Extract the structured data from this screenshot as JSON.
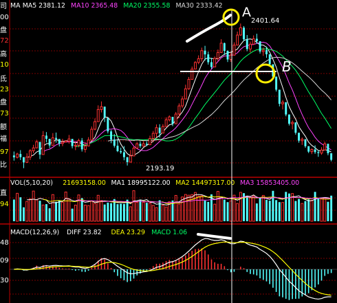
{
  "colors": {
    "background": "#000000",
    "grid": "#7a0000",
    "border": "#bb0000",
    "up": "#ff3232",
    "down": "#54ffff",
    "ma5": "#ffffff",
    "ma10": "#ff44ff",
    "ma20": "#00ff66",
    "ma30": "#d8d8d8",
    "macd_diff": "#ffffff",
    "macd_dea": "#ffff00",
    "annotation": "#ffffff",
    "circle": "#ffee00"
  },
  "price_panel": {
    "legend": [
      {
        "label": "MA",
        "color": "#ffffff"
      },
      {
        "label": "MA5 2381.12",
        "color": "#ffffff"
      },
      {
        "label": "MA10 2365.48",
        "color": "#ff44ff"
      },
      {
        "label": "MA20 2355.58",
        "color": "#00ff66"
      },
      {
        "label": "MA30 2333.42",
        "color": "#d8d8d8"
      }
    ],
    "side_labels": [
      {
        "text": "司",
        "color": "#ffffff"
      },
      {
        "text": "00",
        "color": "#ffffff"
      },
      {
        "text": "盘",
        "color": "#ffffff"
      },
      {
        "text": "72",
        "color": "#ff3232"
      },
      {
        "text": "高",
        "color": "#ffffff"
      },
      {
        "text": "10",
        "color": "#ffff00"
      },
      {
        "text": "氐",
        "color": "#ffffff"
      },
      {
        "text": "23",
        "color": "#ffff00"
      },
      {
        "text": "盘",
        "color": "#ffffff"
      },
      {
        "text": "73",
        "color": "#ffff00"
      },
      {
        "text": "额",
        "color": "#ffffff"
      },
      {
        "text": "福",
        "color": "#ffffff"
      },
      {
        "text": "97",
        "color": "#ffff00"
      },
      {
        "text": "比",
        "color": "#ffffff"
      }
    ],
    "high_label": "2401.64",
    "low_label": "2193.19"
  },
  "volume_panel": {
    "legend": [
      {
        "label": "VOL(5,10,20)",
        "color": "#ffffff"
      },
      {
        "label": "21693158.00",
        "color": "#ffff00"
      },
      {
        "label": "MA1 18995122.00",
        "color": "#ffffff"
      },
      {
        "label": "MA2 14497317.00",
        "color": "#ffff00"
      },
      {
        "label": "MA3 15853405.00",
        "color": "#ff44ff"
      }
    ],
    "side_labels": [
      {
        "text": "直",
        "color": "#ffffff"
      },
      {
        "text": "94",
        "color": "#ffff00"
      }
    ]
  },
  "macd_panel": {
    "legend": [
      {
        "label": "MACD(12,26,9)",
        "color": "#ffffff"
      },
      {
        "label": "DIFF 23.82",
        "color": "#ffffff"
      },
      {
        "label": "DEA 23.29",
        "color": "#ffff00"
      },
      {
        "label": "MACD 1.06",
        "color": "#00ff66"
      }
    ],
    "side_labels": [
      {
        "text": "48",
        "color": "#ffffff"
      },
      {
        "text": "09",
        "color": "#ffffff"
      },
      {
        "text": "30",
        "color": "#ffffff"
      }
    ]
  },
  "annotations": {
    "label_a": "A",
    "label_b": "B"
  },
  "chart_data": [
    {
      "type": "candlestick",
      "title": "",
      "note": "values estimated from the screenshot",
      "ohlc": [
        [
          2208.0,
          2213.8,
          2200.4,
          2205.2
        ],
        [
          2205.2,
          2211.9,
          2203.5,
          2210.1
        ],
        [
          2210.1,
          2215.8,
          2201.3,
          2205.5
        ],
        [
          2205.5,
          2205.5,
          2189.3,
          2197.8
        ],
        [
          2197.8,
          2211.1,
          2197.8,
          2205.6
        ],
        [
          2205.6,
          2217.4,
          2201.4,
          2214.8
        ],
        [
          2214.8,
          2223.6,
          2211.3,
          2219.1
        ],
        [
          2219.1,
          2231.0,
          2218.3,
          2227.9
        ],
        [
          2227.9,
          2227.9,
          2202.7,
          2209.3
        ],
        [
          2209.3,
          2243.8,
          2209.3,
          2237.1
        ],
        [
          2237.1,
          2242.3,
          2227.2,
          2232.4
        ],
        [
          2232.4,
          2232.4,
          2218.8,
          2222.7
        ],
        [
          2222.7,
          2240.8,
          2222.7,
          2233.8
        ],
        [
          2233.8,
          2241.6,
          2226.7,
          2232.1
        ],
        [
          2232.1,
          2232.1,
          2221.2,
          2225.6
        ],
        [
          2225.6,
          2232.4,
          2221.6,
          2227.5
        ],
        [
          2227.5,
          2230.3,
          2226.9,
          2229.1
        ],
        [
          2229.1,
          2238.1,
          2225.2,
          2232.2
        ],
        [
          2232.2,
          2232.2,
          2218.4,
          2221.7
        ],
        [
          2221.7,
          2228.1,
          2215.8,
          2223.0
        ],
        [
          2223.0,
          2232.6,
          2219.9,
          2230.0
        ],
        [
          2230.0,
          2233.6,
          2213.7,
          2216.9
        ],
        [
          2216.9,
          2227.5,
          2212.3,
          2221.8
        ],
        [
          2221.8,
          2234.8,
          2221.8,
          2230.6
        ],
        [
          2230.6,
          2250.5,
          2230.6,
          2246.5
        ],
        [
          2246.5,
          2262.3,
          2244.8,
          2257.6
        ],
        [
          2257.6,
          2281.5,
          2257.6,
          2275.4
        ],
        [
          2275.4,
          2287.3,
          2271.1,
          2279.6
        ],
        [
          2279.6,
          2279.6,
          2257.0,
          2263.3
        ],
        [
          2263.3,
          2263.3,
          2240.3,
          2243.3
        ],
        [
          2243.3,
          2245.7,
          2226.0,
          2231.2
        ],
        [
          2231.2,
          2239.3,
          2219.6,
          2222.2
        ],
        [
          2222.2,
          2232.4,
          2212.9,
          2214.3
        ],
        [
          2214.3,
          2219.5,
          2210.3,
          2212.6
        ],
        [
          2212.6,
          2221.8,
          2200.9,
          2205.5
        ],
        [
          2205.5,
          2205.5,
          2193.2,
          2198.2
        ],
        [
          2198.2,
          2215.9,
          2198.2,
          2207.3
        ],
        [
          2207.3,
          2221.6,
          2207.3,
          2218.8
        ],
        [
          2218.8,
          2227.7,
          2217.8,
          2225.1
        ],
        [
          2225.1,
          2228.8,
          2218.8,
          2221.8
        ],
        [
          2221.8,
          2229.1,
          2220.6,
          2225.1
        ],
        [
          2225.1,
          2228.7,
          2221.7,
          2223.7
        ],
        [
          2223.7,
          2237.0,
          2223.7,
          2232.9
        ],
        [
          2232.9,
          2244.0,
          2227.4,
          2240.4
        ],
        [
          2240.4,
          2253.5,
          2234.2,
          2248.8
        ],
        [
          2248.8,
          2253.8,
          2234.2,
          2240.8
        ],
        [
          2240.8,
          2254.0,
          2240.8,
          2250.5
        ],
        [
          2250.5,
          2263.8,
          2250.5,
          2260.3
        ],
        [
          2260.3,
          2266.8,
          2257.9,
          2264.6
        ],
        [
          2264.6,
          2264.6,
          2251.1,
          2254.5
        ],
        [
          2254.5,
          2271.8,
          2254.5,
          2268.8
        ],
        [
          2268.8,
          2284.4,
          2263.1,
          2280.7
        ],
        [
          2280.7,
          2294.8,
          2277.4,
          2290.9
        ],
        [
          2290.9,
          2311.8,
          2290.9,
          2305.8
        ],
        [
          2305.8,
          2323.2,
          2304.4,
          2319.6
        ],
        [
          2319.6,
          2338.5,
          2319.6,
          2334.7
        ],
        [
          2334.7,
          2346.4,
          2334.7,
          2344.5
        ],
        [
          2344.5,
          2354.9,
          2342.0,
          2349.9
        ],
        [
          2349.9,
          2366.2,
          2345.7,
          2361.8
        ],
        [
          2361.8,
          2368.9,
          2347.3,
          2356.3
        ],
        [
          2356.3,
          2360.3,
          2341.3,
          2344.8
        ],
        [
          2344.8,
          2351.3,
          2335.2,
          2337.9
        ],
        [
          2337.9,
          2353.3,
          2337.9,
          2350.4
        ],
        [
          2350.4,
          2363.5,
          2346.7,
          2359.1
        ],
        [
          2359.1,
          2378.6,
          2358.3,
          2372.8
        ],
        [
          2372.8,
          2373.7,
          2355.5,
          2361.5
        ],
        [
          2361.5,
          2362.2,
          2345.1,
          2348.9
        ],
        [
          2348.9,
          2358.7,
          2345.3,
          2355.2
        ],
        [
          2355.2,
          2374.0,
          2354.5,
          2369.9
        ],
        [
          2369.9,
          2389.8,
          2369.9,
          2384.7
        ],
        [
          2384.7,
          2401.6,
          2383.6,
          2395.5
        ],
        [
          2395.5,
          2397.9,
          2375.6,
          2378.5
        ],
        [
          2378.5,
          2384.7,
          2361.0,
          2364.2
        ],
        [
          2364.2,
          2375.1,
          2359.2,
          2371.3
        ],
        [
          2371.3,
          2384.2,
          2371.3,
          2379.2
        ],
        [
          2379.2,
          2386.6,
          2372.1,
          2375.7
        ],
        [
          2375.7,
          2375.7,
          2357.5,
          2360.5
        ],
        [
          2360.5,
          2366.3,
          2354.1,
          2362.5
        ],
        [
          2362.5,
          2367.7,
          2351.3,
          2356.5
        ],
        [
          2356.5,
          2356.5,
          2339.9,
          2341.8
        ],
        [
          2341.8,
          2341.8,
          2320.5,
          2323.7
        ],
        [
          2323.7,
          2323.7,
          2301.8,
          2304.5
        ],
        [
          2304.5,
          2304.5,
          2280.0,
          2283.8
        ],
        [
          2283.8,
          2289.4,
          2275.5,
          2286.1
        ],
        [
          2286.1,
          2286.1,
          2265.5,
          2268.1
        ],
        [
          2268.1,
          2268.1,
          2252.0,
          2254.6
        ],
        [
          2254.6,
          2259.4,
          2246.3,
          2256.5
        ],
        [
          2256.5,
          2256.5,
          2238.5,
          2241.3
        ],
        [
          2241.3,
          2241.3,
          2226.7,
          2229.7
        ],
        [
          2229.7,
          2234.4,
          2223.5,
          2231.8
        ],
        [
          2231.8,
          2231.8,
          2219.2,
          2221.6
        ],
        [
          2221.6,
          2221.6,
          2211.5,
          2213.6
        ],
        [
          2213.6,
          2218.4,
          2210.0,
          2216.7
        ],
        [
          2216.7,
          2222.9,
          2210.4,
          2212.9
        ],
        [
          2212.9,
          2215.8,
          2206.0,
          2211.5
        ],
        [
          2211.5,
          2220.1,
          2209.0,
          2216.0
        ],
        [
          2216.0,
          2228.2,
          2215.2,
          2225.1
        ],
        [
          2225.1,
          2225.1,
          2208.2,
          2211.2
        ],
        [
          2211.2,
          2211.2,
          2199.3,
          2201.6
        ]
      ],
      "ylim": [
        2180,
        2420
      ],
      "high": 2401.64,
      "low": 2193.19,
      "ma_periods": [
        5,
        10,
        20,
        30
      ]
    },
    {
      "type": "bar",
      "title": "VOL(5,10,20)",
      "values": [
        18.4,
        23.7,
        20.3,
        11.8,
        16.8,
        18.9,
        25.6,
        18.2,
        17.4,
        13.8,
        14.5,
        11.0,
        22.6,
        16.5,
        17.6,
        16.2,
        24.8,
        19.1,
        10.7,
        13.7,
        22.3,
        19.6,
        13.7,
        13.3,
        17.3,
        15.1,
        22.0,
        17.6,
        14.2,
        15.8,
        15.3,
        18.8,
        14.5,
        14.9,
        14.6,
        18.3,
        12.3,
        25.9,
        16.1,
        17.9,
        16.1,
        15.6,
        15.5,
        13.5,
        11.6,
        17.8,
        13.7,
        12.1,
        16.5,
        17.6,
        21.9,
        14.5,
        20.6,
        22.7,
        22.1,
        22.6,
        24.4,
        21.4,
        21.6,
        17.5,
        16.4,
        22.8,
        14.5,
        25.3,
        20.7,
        18.3,
        16.2,
        17.3,
        22.1,
        15.1,
        24.5,
        23.8,
        21.5,
        20.4,
        21.5,
        15.1,
        19.8,
        21.9,
        18.1,
        17.4,
        25.8,
        17.9,
        16.2,
        15.9,
        24.9,
        23.5,
        23.5,
        17.2,
        18.9,
        15.1,
        17.1,
        18.5,
        17.9,
        24.9,
        19.1,
        18.9,
        20.0,
        16.5,
        21.7
      ],
      "unit": "millions",
      "ma_periods": [
        5,
        10,
        20
      ]
    },
    {
      "type": "bar",
      "title": "MACD(12,26,9)",
      "series": [
        {
          "name": "DIFF",
          "values": [
            0.0,
            0.4,
            0.24,
            -0.64,
            -0.7,
            -0.03,
            0.93,
            2.32,
            1.96,
            3.26,
            3.83,
            3.44,
            3.97,
            4.2,
            3.81,
            3.61,
            3.52,
            3.69,
            2.92,
            2.39,
            2.53,
            1.53,
            1.11,
            1.56,
            3.15,
            5.18,
            8.15,
            10.71,
            11.36,
            10.16,
            8.11,
            5.72,
            3.17,
            0.99,
            -1.28,
            -3.66,
            -4.68,
            -4.53,
            -3.72,
            -3.3,
            -2.68,
            -2.27,
            -1.18,
            0.29,
            2.07,
            2.79,
            4.1,
            5.88,
            7.55,
            8.01,
            9.38,
            11.27,
            13.47,
            16.15,
            19.18,
            22.49,
            25.68,
            28.33,
            31.0,
            32.35,
            32.15,
            30.98,
            30.44,
            30.41,
            31.07,
            30.29,
            28.33,
            26.95,
            26.89,
            28.1,
            29.63,
            29.1,
            26.95,
            25.43,
            24.6,
            23.39,
            20.97,
            18.98,
            16.79,
            13.74,
            9.79,
            5.07,
            -0.26,
            -4.09,
            -8.3,
            -12.56,
            -15.64,
            -19.08,
            -22.48,
            -24.7,
            -26.89,
            -29.0,
            -30.06,
            -30.9,
            -31.27,
            -30.79,
            -29.31,
            -28.91,
            -28.92
          ]
        },
        {
          "name": "DEA",
          "values": [
            0.0,
            0.08,
            0.11,
            -0.04,
            -0.17,
            -0.14,
            0.07,
            0.52,
            0.81,
            1.3,
            1.81,
            2.14,
            2.5,
            2.84,
            3.04,
            3.15,
            3.23,
            3.32,
            3.24,
            3.07,
            2.96,
            2.67,
            2.36,
            2.2,
            2.39,
            2.95,
            3.99,
            5.33,
            6.54,
            7.27,
            7.44,
            7.1,
            6.31,
            5.25,
            3.94,
            2.42,
            1.0,
            -0.11,
            -0.83,
            -1.32,
            -1.59,
            -1.73,
            -1.62,
            -1.24,
            -0.58,
            0.09,
            0.89,
            1.88,
            3.02,
            4.02,
            5.09,
            6.32,
            7.75,
            9.43,
            11.38,
            13.6,
            16.02,
            18.48,
            20.99,
            23.26,
            25.04,
            26.23,
            27.07,
            27.74,
            28.41,
            28.79,
            28.7,
            28.35,
            28.06,
            28.07,
            28.38,
            28.52,
            28.21,
            27.65,
            27.04,
            26.31,
            25.24,
            23.99,
            22.55,
            20.79,
            18.59,
            15.88,
            12.65,
            9.3,
            5.78,
            2.11,
            -1.44,
            -4.97,
            -8.47,
            -11.72,
            -14.75,
            -17.6,
            -20.09,
            -22.25,
            -24.05,
            -25.4,
            -26.18,
            -26.73,
            -27.17
          ]
        },
        {
          "name": "MACD",
          "values": [
            0.0,
            0.32,
            0.13,
            -0.6,
            -0.53,
            0.11,
            0.86,
            1.8,
            1.15,
            1.96,
            2.02,
            1.3,
            1.47,
            1.36,
            0.77,
            0.46,
            0.29,
            0.37,
            -0.32,
            -0.68,
            -0.43,
            -1.14,
            -1.25,
            -0.64,
            0.76,
            2.23,
            4.16,
            5.38,
            4.82,
            2.89,
            0.67,
            -1.38,
            -3.14,
            -4.26,
            -5.22,
            -6.08,
            -5.68,
            -4.42,
            -2.89,
            -1.98,
            -1.09,
            -0.54,
            0.44,
            1.53,
            2.65,
            2.7,
            3.21,
            4.0,
            4.53,
            3.99,
            4.29,
            4.95,
            5.72,
            6.72,
            7.8,
            8.89,
            9.66,
            9.85,
            10.01,
            9.09,
            7.11,
            4.75,
            3.37,
            2.67,
            2.66,
            1.5,
            -0.37,
            -1.4,
            -1.17,
            0.03,
            1.25,
            0.58,
            -1.26,
            -2.22,
            -2.44,
            -2.92,
            -4.27,
            -5.01,
            -5.76,
            -7.05,
            -8.8,
            -10.81,
            -12.91,
            -13.39,
            -14.08,
            -14.67,
            -14.2,
            -14.11,
            -14.01,
            -12.98,
            -12.14,
            -11.4,
            -9.97,
            -8.65,
            -7.22,
            -5.39,
            -3.13,
            -2.18,
            -1.75
          ]
        }
      ]
    }
  ]
}
